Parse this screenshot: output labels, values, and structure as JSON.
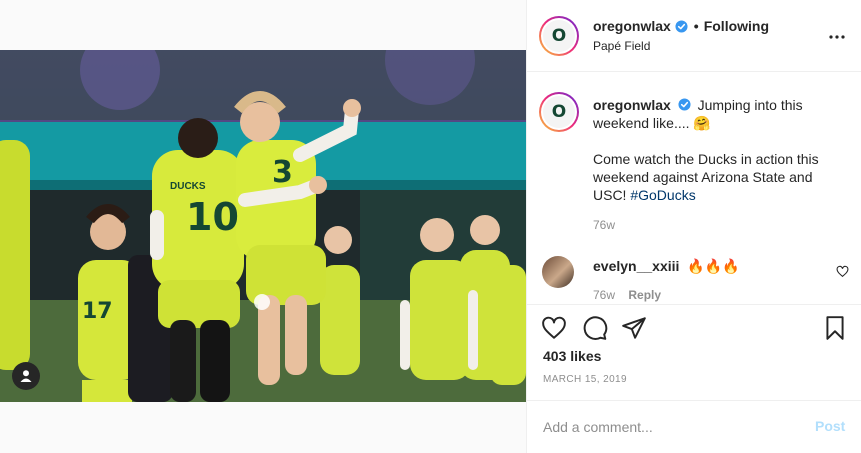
{
  "post": {
    "author": "oregonwlax",
    "follow_status": "Following",
    "location": "Papé Field",
    "avatar_letter": "O",
    "caption_text": "Jumping into this weekend like.... 🤗",
    "caption_line2": "Come watch the Ducks in action this weekend against Arizona State and USC!",
    "hashtag": "#GoDucks",
    "caption_time": "76w",
    "likes": "403 likes",
    "date": "MARCH 15, 2019"
  },
  "image": {
    "jersey_front": "10",
    "jersey_back": "3",
    "jersey_left": "17",
    "jersey_word": "DUCKS"
  },
  "comment": {
    "user": "evelyn__xxiii",
    "text": "🔥🔥🔥",
    "time": "76w",
    "reply_label": "Reply"
  },
  "add_comment": {
    "placeholder": "Add a comment...",
    "post_label": "Post"
  },
  "colors": {
    "brand_green": "#154733",
    "brand_yellow": "#fee11a",
    "jersey": "#d7ea3c",
    "verified_blue": "#3897f0",
    "link_blue": "#00376b",
    "post_disabled": "#b2dffc"
  },
  "icons": {
    "verified": "verified-badge-icon",
    "more": "more-options-icon",
    "heart": "heart-icon",
    "comment": "comment-icon",
    "share": "share-icon",
    "save": "bookmark-icon",
    "tag": "user-tag-icon"
  }
}
